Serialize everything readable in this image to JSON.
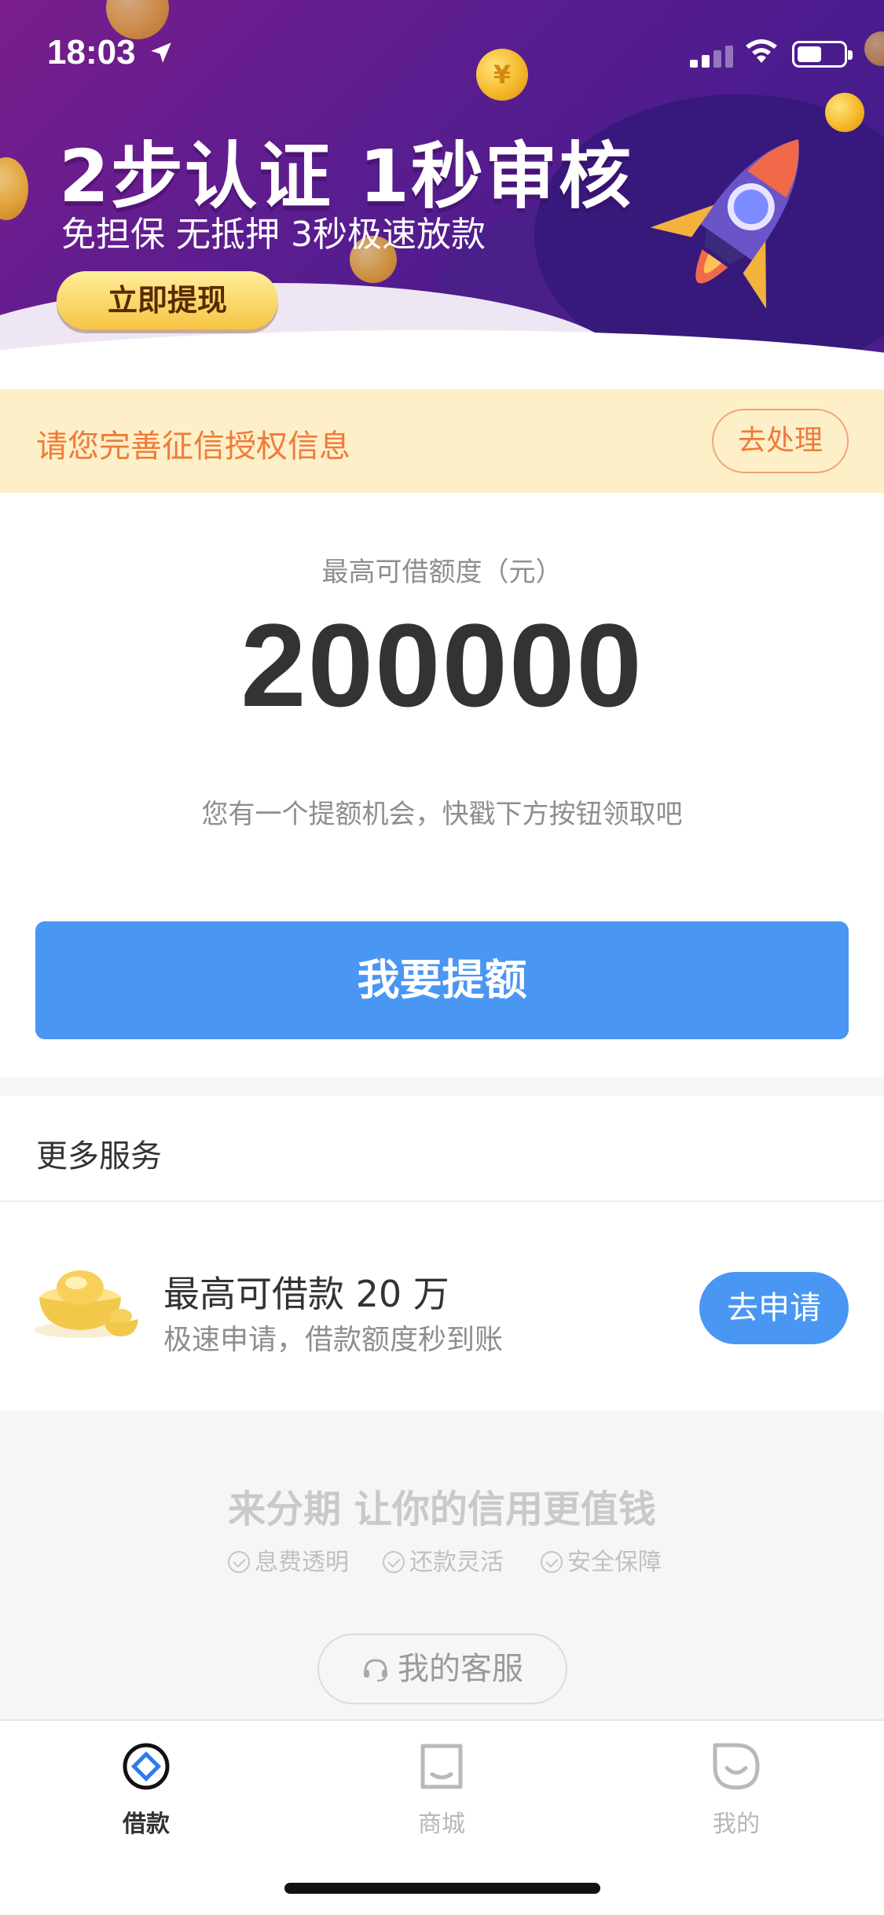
{
  "status_bar": {
    "time": "18:03"
  },
  "banner": {
    "title": "2步认证 1秒审核",
    "subtitle": "免担保 无抵押 3秒极速放款",
    "button": "立即提现",
    "coin_symbol": "¥"
  },
  "notice": {
    "text": "请您完善征信授权信息",
    "button": "去处理"
  },
  "quota": {
    "label": "最高可借额度（元）",
    "amount": "200000",
    "hint": "您有一个提额机会，快戳下方按钮领取吧",
    "button": "我要提额"
  },
  "more_services": {
    "title": "更多服务",
    "item": {
      "title": "最高可借款 20 万",
      "subtitle": "极速申请，借款额度秒到账",
      "button": "去申请",
      "icon": "gold-ingot-icon"
    }
  },
  "footer": {
    "slogan": "来分期  让你的信用更值钱",
    "features": [
      "息费透明",
      "还款灵活",
      "安全保障"
    ],
    "service_button": "我的客服"
  },
  "tabbar": {
    "items": [
      {
        "label": "借款",
        "icon": "loan-icon",
        "active": true
      },
      {
        "label": "商城",
        "icon": "shop-icon",
        "active": false
      },
      {
        "label": "我的",
        "icon": "profile-icon",
        "active": false
      }
    ]
  },
  "colors": {
    "primary": "#4a96f3",
    "notice_bg": "#fdf0c8",
    "notice_text": "#f07a3a",
    "banner": "#5a1d8f"
  }
}
